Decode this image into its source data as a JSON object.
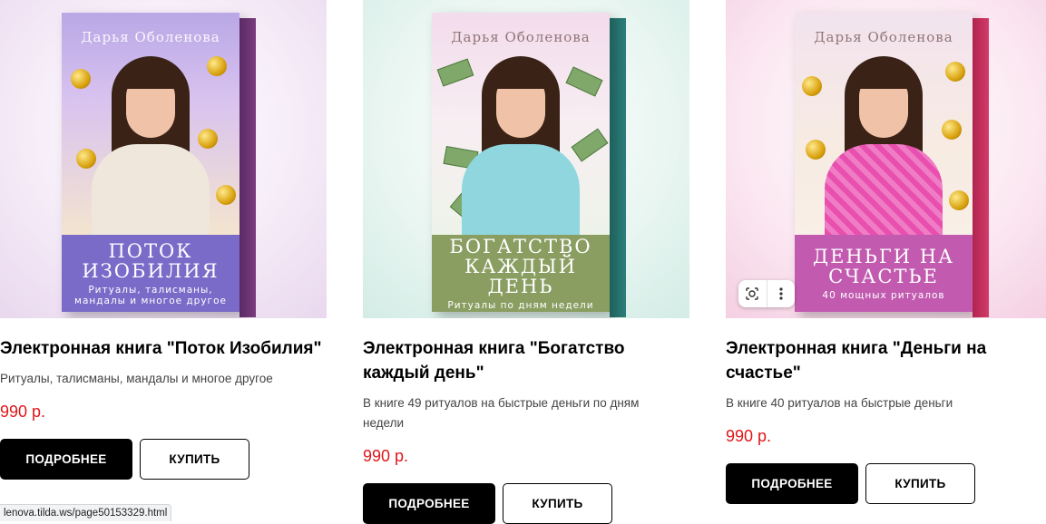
{
  "products": [
    {
      "cover": {
        "author": "Дарья Оболенова",
        "band_title": "Поток изобилия",
        "band_sub": "Ритуалы, талисманы, мандалы и многое другое"
      },
      "title": "Электронная книга \"Поток Изобилия\"",
      "description": "Ритуалы, талисманы, мандалы и многое другое",
      "price": "990 р.",
      "more_label": "ПОДРОБНЕЕ",
      "buy_label": "КУПИТЬ"
    },
    {
      "cover": {
        "author": "Дарья Оболенова",
        "band_title": "Богатство каждый день",
        "band_sub": "Ритуалы по дням недели"
      },
      "title": "Электронная книга \"Богатство каждый день\"",
      "description": "В книге 49 ритуалов на быстрые деньги по дням недели",
      "price": "990 р.",
      "more_label": "ПОДРОБНЕЕ",
      "buy_label": "КУПИТЬ"
    },
    {
      "cover": {
        "author": "Дарья Оболенова",
        "band_title": "Деньги на счастье",
        "band_sub": "40 мощных ритуалов"
      },
      "title": "Электронная книга \"Деньги на счастье\"",
      "description": "В книге 40 ритуалов на быстрые деньги",
      "price": "990 р.",
      "more_label": "ПОДРОБНЕЕ",
      "buy_label": "КУПИТЬ"
    }
  ],
  "image_overlay": {
    "lens_icon": "camera-lens-icon",
    "more_icon": "more-vertical-icon"
  },
  "status_bar": {
    "url": "lenova.tilda.ws/page50153329.html"
  },
  "colors": {
    "price": "#e0161a",
    "primary_button": "#000000"
  }
}
